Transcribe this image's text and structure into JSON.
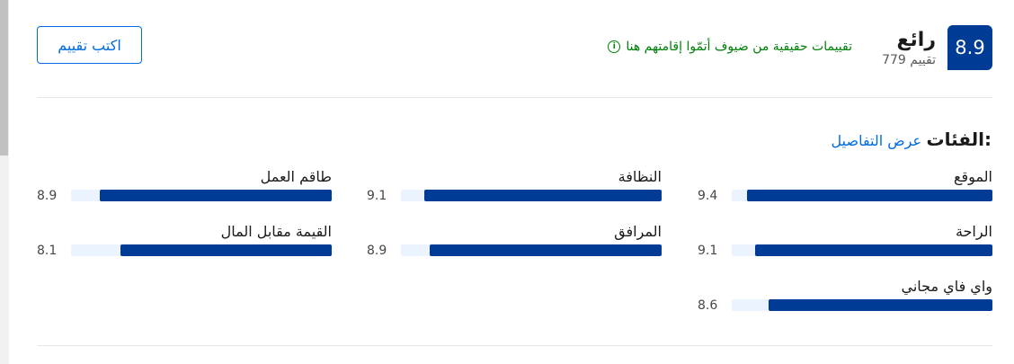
{
  "header": {
    "score": "8.9",
    "rating_word": "رائع",
    "review_count": "779 تقييم",
    "verified_text": "تقييمات حقيقية من ضيوف أتمّوا إقامتهم هنا",
    "verified_icon": "info-circle-icon",
    "write_review_label": "اكتب تقييم"
  },
  "categories": {
    "title": "الفئات:",
    "details_link": "عرض التفاصيل",
    "items": [
      {
        "label": "الموقع",
        "score": "9.4",
        "value": 9.4
      },
      {
        "label": "النظافة",
        "score": "9.1",
        "value": 9.1
      },
      {
        "label": "طاقم العمل",
        "score": "8.9",
        "value": 8.9
      },
      {
        "label": "الراحة",
        "score": "9.1",
        "value": 9.1
      },
      {
        "label": "المرافق",
        "score": "8.9",
        "value": 8.9
      },
      {
        "label": "القيمة مقابل المال",
        "score": "8.1",
        "value": 8.1
      },
      {
        "label": "واي فاي مجاني",
        "score": "8.6",
        "value": 8.6
      }
    ],
    "max_score": 10
  },
  "colors": {
    "brand": "#003b95",
    "link": "#006ce4",
    "verified": "#008009",
    "track": "#ebf3ff"
  }
}
